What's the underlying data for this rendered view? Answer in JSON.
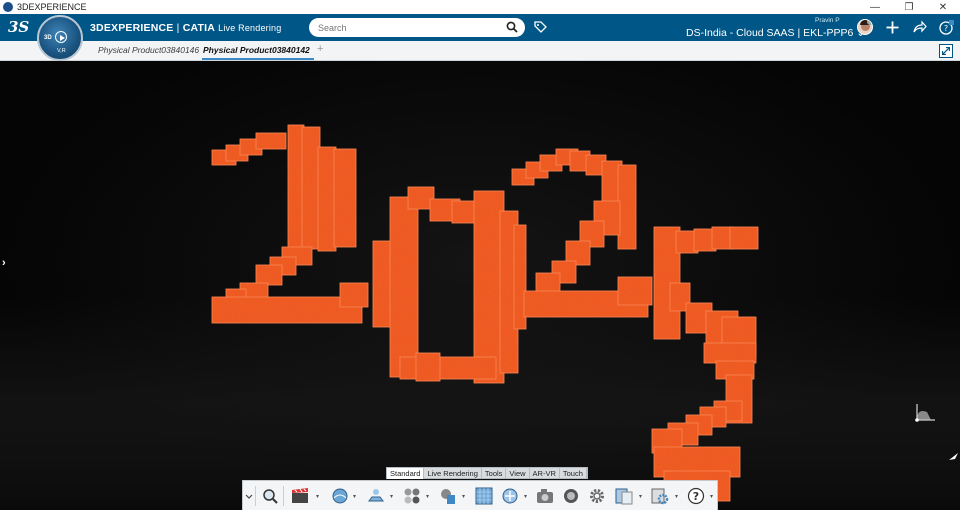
{
  "window": {
    "title": "3DEXPERIENCE",
    "minimize": "—",
    "restore": "❐",
    "close": "✕"
  },
  "header": {
    "logo": "3S",
    "brand": "3DEXPERIENCE",
    "separator": " | ",
    "app": "CATIA",
    "role": "Live Rendering",
    "search_placeholder": "Search",
    "user_name": "Pravin P",
    "tenant": "DS-India - Cloud SAAS | EKL-PPP6",
    "tenant_caret": "⌄"
  },
  "compass": {
    "label_3d": "3D",
    "label_vr": "V,R"
  },
  "tabs": [
    {
      "label": "Physical Product03840146"
    },
    {
      "label": "Physical Product03840142"
    }
  ],
  "tab_add": "+",
  "viewport": {
    "left_expander": "›",
    "model_color": "#f1531f"
  },
  "toolbar_tabs": [
    {
      "label": "Standard"
    },
    {
      "label": "Live Rendering"
    },
    {
      "label": "Tools"
    },
    {
      "label": "View"
    },
    {
      "label": "AR-VR"
    },
    {
      "label": "Touch"
    }
  ],
  "toolbar_caret": "▾",
  "colors": {
    "header": "#005686",
    "accent": "#3c8ac7",
    "model": "#f1531f"
  }
}
